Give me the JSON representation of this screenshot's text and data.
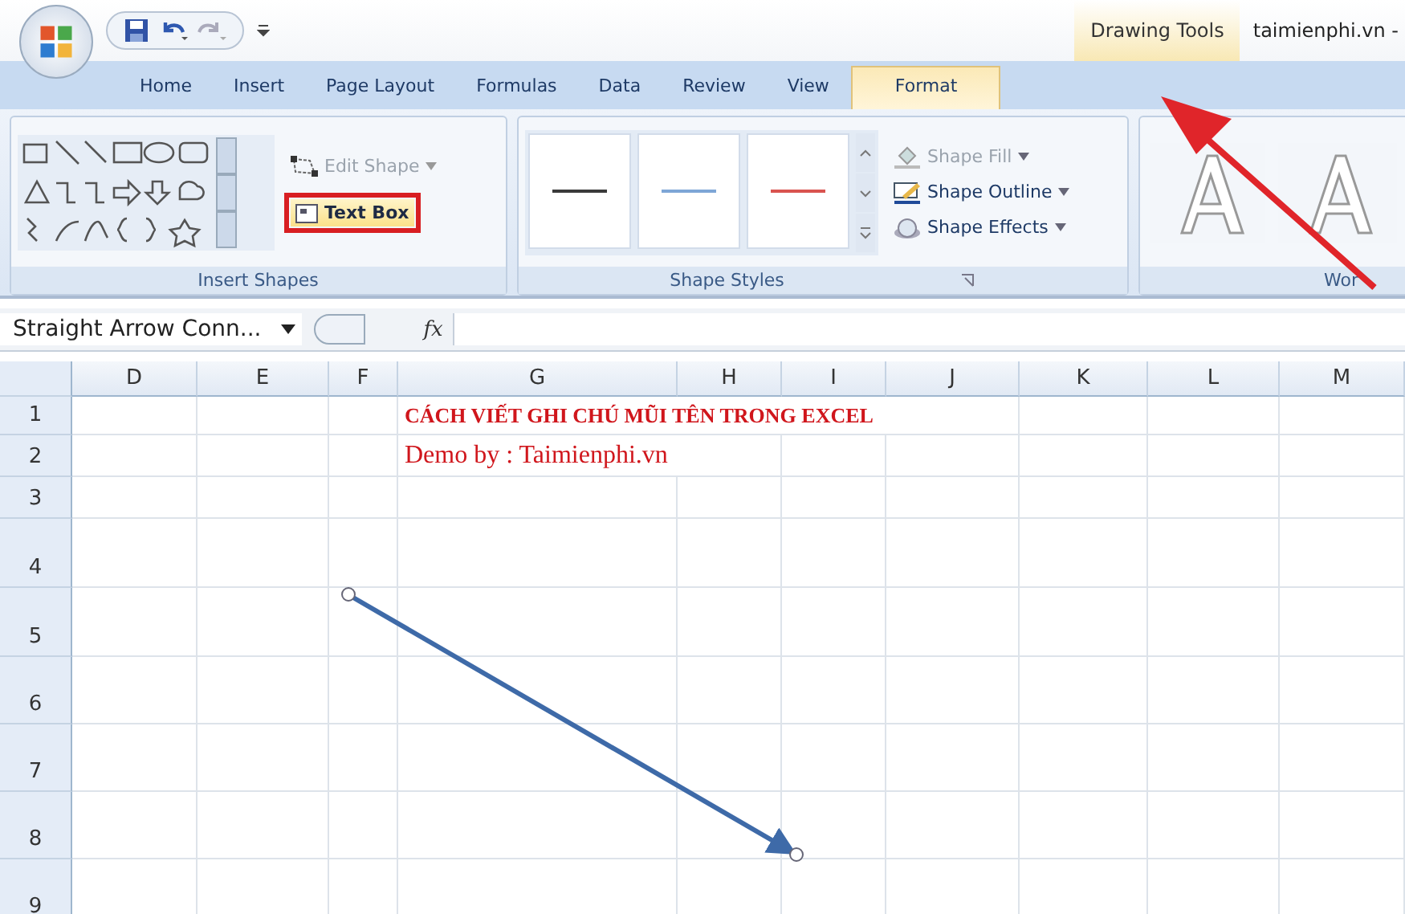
{
  "title_bar": {
    "context_label": "Drawing Tools",
    "title": "taimienphi.vn -"
  },
  "tabs": [
    {
      "label": "Home",
      "selected": false
    },
    {
      "label": "Insert",
      "selected": false
    },
    {
      "label": "Page Layout",
      "selected": false
    },
    {
      "label": "Formulas",
      "selected": false
    },
    {
      "label": "Data",
      "selected": false
    },
    {
      "label": "Review",
      "selected": false
    },
    {
      "label": "View",
      "selected": false
    },
    {
      "label": "Format",
      "selected": true
    }
  ],
  "insert_shapes": {
    "label": "Insert Shapes",
    "edit_shape": {
      "label": "Edit Shape",
      "disabled": true
    },
    "text_box": {
      "label": "Text Box",
      "disabled": false
    }
  },
  "shape_styles": {
    "label": "Shape Styles",
    "styles": [
      {
        "color": "#3a3a3a"
      },
      {
        "color": "#7ea6d6"
      },
      {
        "color": "#d9534f"
      }
    ],
    "buttons": [
      {
        "label": "Shape Fill",
        "disabled": true
      },
      {
        "label": "Shape Outline",
        "disabled": false
      },
      {
        "label": "Shape Effects",
        "disabled": false
      }
    ]
  },
  "wordart": {
    "label": "Wor"
  },
  "formula_bar": {
    "name_box": "Straight Arrow Conn...",
    "function_label": "fx"
  },
  "sheet": {
    "columns": [
      "D",
      "E",
      "F",
      "G",
      "H",
      "I",
      "J",
      "K",
      "L",
      "M"
    ],
    "rows": [
      {
        "header": "1",
        "text": "CÁCH VIẾT GHI CHÚ MŨI TÊN TRONG EXCEL",
        "kind": "title"
      },
      {
        "header": "2",
        "text": "Demo by : Taimienphi.vn",
        "kind": "plain"
      },
      {
        "header": "3"
      },
      {
        "header": "4"
      },
      {
        "header": "5"
      },
      {
        "header": "6"
      },
      {
        "header": "7"
      },
      {
        "header": "8"
      },
      {
        "header": "9"
      }
    ]
  }
}
